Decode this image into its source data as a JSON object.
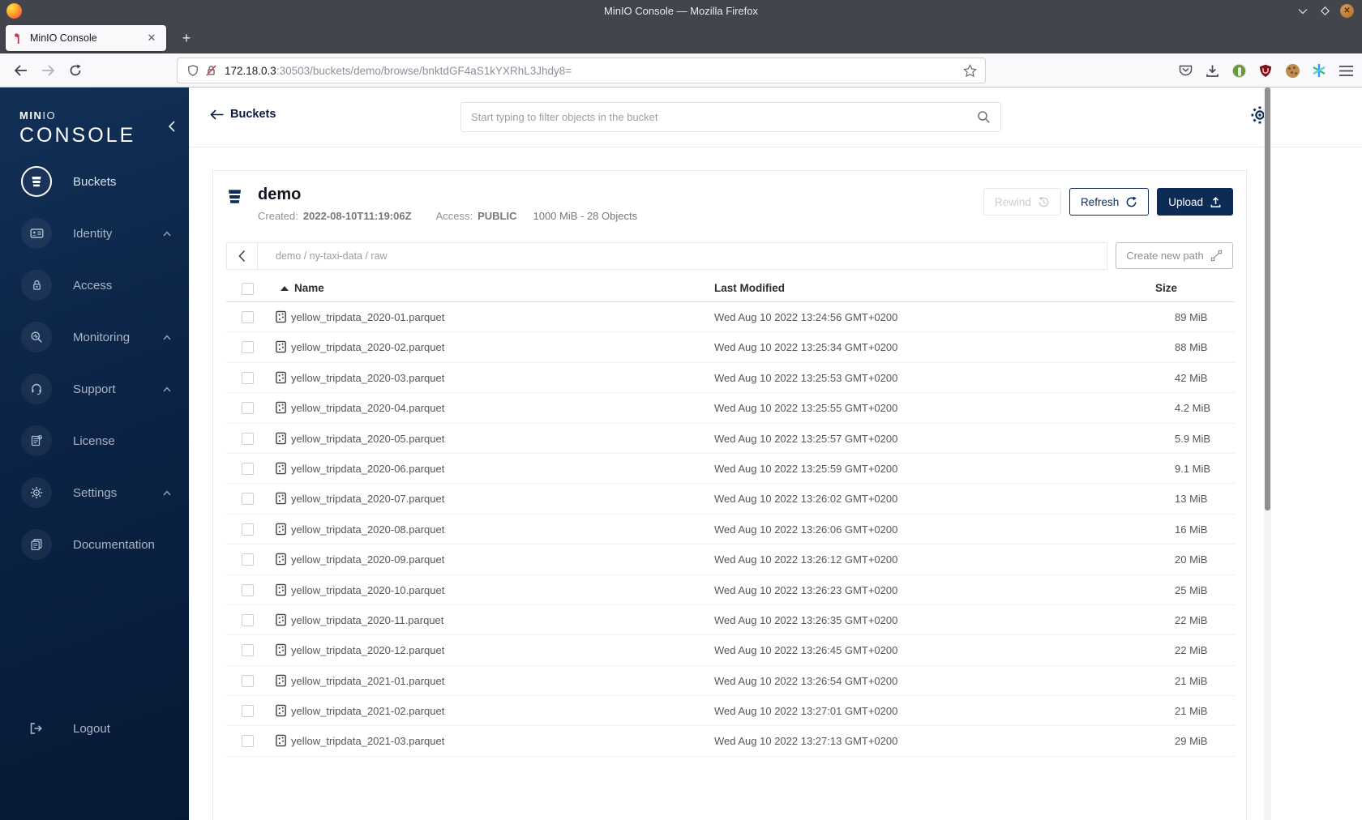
{
  "window": {
    "title": "MinIO Console — Mozilla Firefox"
  },
  "tab": {
    "title": "MinIO Console",
    "new_tab_label": "+",
    "close_label": "✕"
  },
  "urlbar": {
    "host": "172.18.0.3",
    "path": ":30503/buckets/demo/browse/bnktdGF4aS1kYXRhL3Jhdy8="
  },
  "sidebar": {
    "logo": {
      "min": "MIN",
      "io": "IO",
      "console": "CONSOLE"
    },
    "items": [
      {
        "label": "Buckets"
      },
      {
        "label": "Identity"
      },
      {
        "label": "Access"
      },
      {
        "label": "Monitoring"
      },
      {
        "label": "Support"
      },
      {
        "label": "License"
      },
      {
        "label": "Settings"
      },
      {
        "label": "Documentation"
      }
    ],
    "logout_label": "Logout"
  },
  "header": {
    "back_label": "Buckets",
    "search_placeholder": "Start typing to filter objects in the bucket"
  },
  "bucket": {
    "name": "demo",
    "created_label": "Created:",
    "created_value": "2022-08-10T11:19:06Z",
    "access_label": "Access:",
    "access_value": "PUBLIC",
    "usage": "1000 MiB - 28 Objects",
    "rewind_label": "Rewind",
    "refresh_label": "Refresh",
    "upload_label": "Upload"
  },
  "browse": {
    "path": "demo / ny-taxi-data / raw",
    "create_path_label": "Create new path"
  },
  "table": {
    "headers": {
      "name": "Name",
      "modified": "Last Modified",
      "size": "Size"
    },
    "rows": [
      {
        "name": "yellow_tripdata_2020-01.parquet",
        "modified": "Wed Aug 10 2022 13:24:56 GMT+0200",
        "size": "89 MiB"
      },
      {
        "name": "yellow_tripdata_2020-02.parquet",
        "modified": "Wed Aug 10 2022 13:25:34 GMT+0200",
        "size": "88 MiB"
      },
      {
        "name": "yellow_tripdata_2020-03.parquet",
        "modified": "Wed Aug 10 2022 13:25:53 GMT+0200",
        "size": "42 MiB"
      },
      {
        "name": "yellow_tripdata_2020-04.parquet",
        "modified": "Wed Aug 10 2022 13:25:55 GMT+0200",
        "size": "4.2 MiB"
      },
      {
        "name": "yellow_tripdata_2020-05.parquet",
        "modified": "Wed Aug 10 2022 13:25:57 GMT+0200",
        "size": "5.9 MiB"
      },
      {
        "name": "yellow_tripdata_2020-06.parquet",
        "modified": "Wed Aug 10 2022 13:25:59 GMT+0200",
        "size": "9.1 MiB"
      },
      {
        "name": "yellow_tripdata_2020-07.parquet",
        "modified": "Wed Aug 10 2022 13:26:02 GMT+0200",
        "size": "13 MiB"
      },
      {
        "name": "yellow_tripdata_2020-08.parquet",
        "modified": "Wed Aug 10 2022 13:26:06 GMT+0200",
        "size": "16 MiB"
      },
      {
        "name": "yellow_tripdata_2020-09.parquet",
        "modified": "Wed Aug 10 2022 13:26:12 GMT+0200",
        "size": "20 MiB"
      },
      {
        "name": "yellow_tripdata_2020-10.parquet",
        "modified": "Wed Aug 10 2022 13:26:23 GMT+0200",
        "size": "25 MiB"
      },
      {
        "name": "yellow_tripdata_2020-11.parquet",
        "modified": "Wed Aug 10 2022 13:26:35 GMT+0200",
        "size": "22 MiB"
      },
      {
        "name": "yellow_tripdata_2020-12.parquet",
        "modified": "Wed Aug 10 2022 13:26:45 GMT+0200",
        "size": "22 MiB"
      },
      {
        "name": "yellow_tripdata_2021-01.parquet",
        "modified": "Wed Aug 10 2022 13:26:54 GMT+0200",
        "size": "21 MiB"
      },
      {
        "name": "yellow_tripdata_2021-02.parquet",
        "modified": "Wed Aug 10 2022 13:27:01 GMT+0200",
        "size": "21 MiB"
      },
      {
        "name": "yellow_tripdata_2021-03.parquet",
        "modified": "Wed Aug 10 2022 13:27:13 GMT+0200",
        "size": "29 MiB"
      }
    ]
  },
  "colors": {
    "accent_navy": "#0c2c55",
    "sidebar_navy": "#0b2345",
    "minio_red": "#c9364f"
  }
}
